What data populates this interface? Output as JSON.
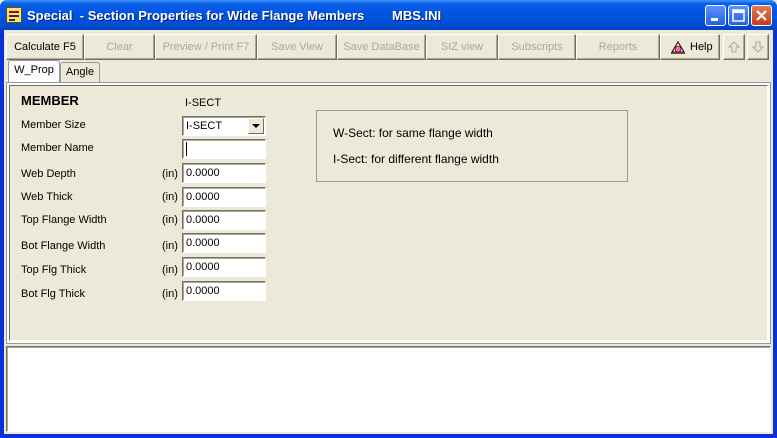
{
  "window": {
    "title": "Special  - Section Properties for Wide Flange Members",
    "file": "MBS.INI"
  },
  "toolbar": {
    "calculate": "Calculate  F5",
    "clear": "Clear",
    "preview": "Preview / Print F7",
    "save_view": "Save View",
    "save_database": "Save DataBase",
    "siz_view": "SIZ view",
    "subscripts": "Subscripts",
    "reports": "Reports",
    "help": "Help"
  },
  "tabs": [
    "W_Prop",
    "Angle"
  ],
  "form": {
    "heading": "MEMBER",
    "section_type": "I-SECT",
    "member_size_label": "Member Size",
    "member_size_value": "I-SECT",
    "member_name_label": "Member Name",
    "member_name_value": "",
    "unit": "(in)",
    "fields": [
      {
        "label": "Web Depth",
        "value": "0.0000"
      },
      {
        "label": "Web Thick",
        "value": "0.0000"
      },
      {
        "label": "Top Flange Width",
        "value": "0.0000"
      },
      {
        "label": "Bot Flange Width",
        "value": "0.0000"
      },
      {
        "label": "Top Flg Thick",
        "value": "0.0000"
      },
      {
        "label": "Bot Flg Thick",
        "value": "0.0000"
      }
    ]
  },
  "info": {
    "line1": "W-Sect: for same flange width",
    "line2": "I-Sect: for different flange width"
  },
  "colors": {
    "titlebar": "#0054e3",
    "face": "#ece9d8",
    "disabled_text": "#aca899"
  }
}
